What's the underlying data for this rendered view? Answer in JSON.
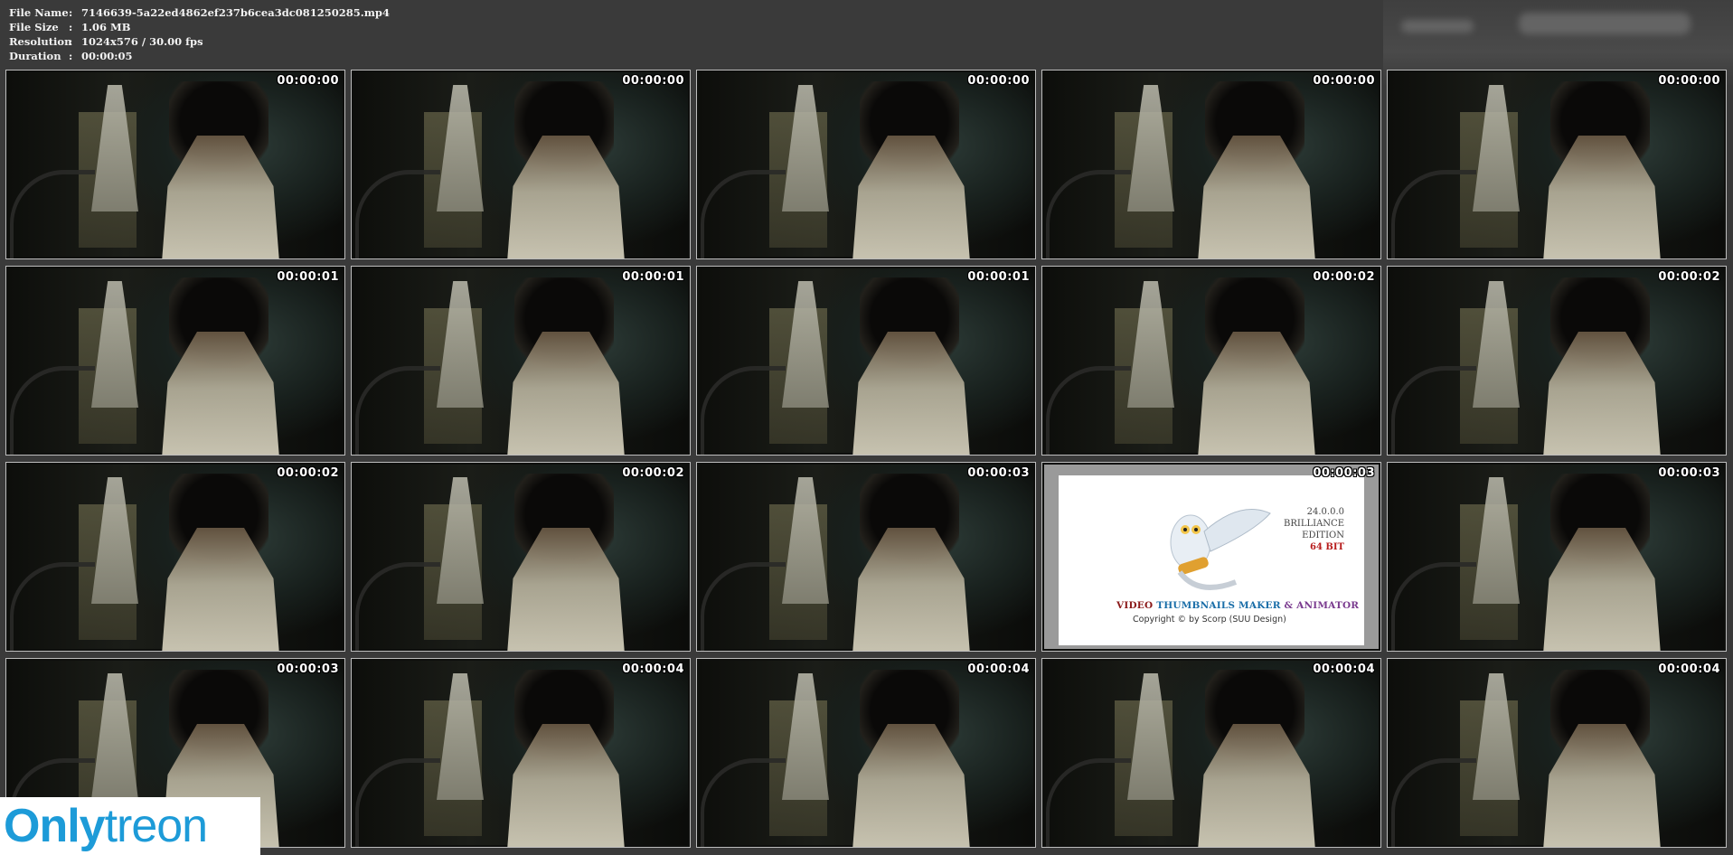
{
  "file_info": {
    "rows": [
      {
        "label": "File Name",
        "sep": ":",
        "value": "7146639-5a22ed4862ef237b6cea3dc081250285.mp4"
      },
      {
        "label": "File Size",
        "sep": ":",
        "value": "1.06 MB"
      },
      {
        "label": "Resolution",
        "sep": ":",
        "value": "1024x576 / 30.00 fps"
      },
      {
        "label": "Duration",
        "sep": ":",
        "value": "00:00:05"
      }
    ]
  },
  "thumbnails": [
    {
      "time": "00:00:00"
    },
    {
      "time": "00:00:00"
    },
    {
      "time": "00:00:00"
    },
    {
      "time": "00:00:00"
    },
    {
      "time": "00:00:00"
    },
    {
      "time": "00:00:01"
    },
    {
      "time": "00:00:01"
    },
    {
      "time": "00:00:01"
    },
    {
      "time": "00:00:02"
    },
    {
      "time": "00:00:02"
    },
    {
      "time": "00:00:02"
    },
    {
      "time": "00:00:02"
    },
    {
      "time": "00:00:03"
    },
    {
      "time": "00:00:03",
      "ad": true
    },
    {
      "time": "00:00:03"
    },
    {
      "time": "00:00:03"
    },
    {
      "time": "00:00:04"
    },
    {
      "time": "00:00:04"
    },
    {
      "time": "00:00:04"
    },
    {
      "time": "00:00:04"
    }
  ],
  "ad": {
    "version": "24.0.0.0",
    "edition_line1": "BRILLIANCE",
    "edition_line2": "EDITION",
    "bits": "64 BIT",
    "title_v": "VIDEO",
    "title_t": "THUMBNAILS MAKER",
    "title_amp": "&",
    "title_a": "ANIMATOR",
    "copyright": "Copyright © by Scorp (SUU Design)"
  },
  "watermark": {
    "part1": "Only",
    "part2": "treon"
  },
  "colors": {
    "background": "#3a3a3a",
    "logo_blue": "#1d9bd8",
    "ad_bits_red": "#b71c1c"
  }
}
